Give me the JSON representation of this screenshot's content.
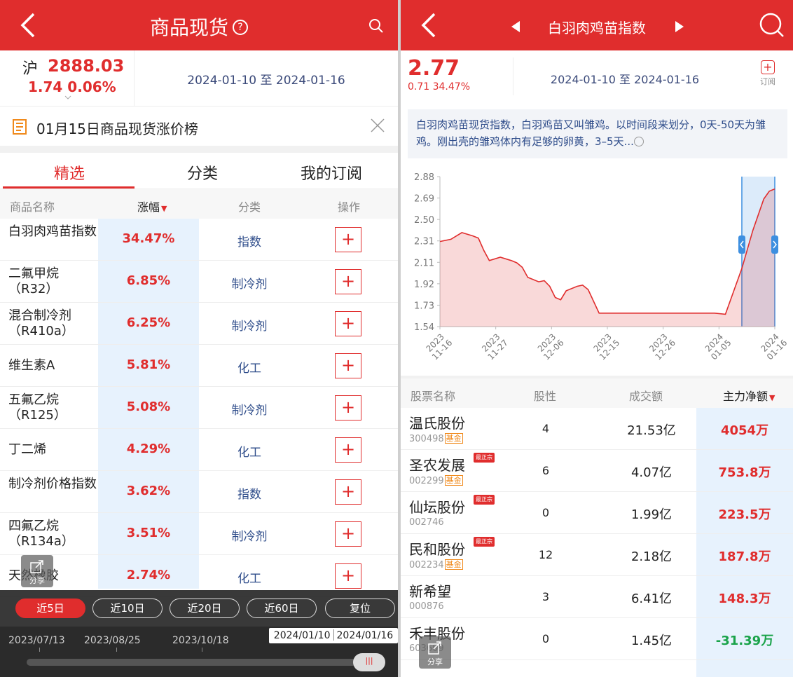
{
  "colors": {
    "brand_red": "#e02d2d",
    "up": "#e02d2d",
    "down": "#1aa34a",
    "link_blue": "#2e4c8a",
    "sort_bg": "#e7f2fd"
  },
  "left": {
    "header": {
      "title": "商品现货",
      "help_icon": "?"
    },
    "index": {
      "name": "沪",
      "value": "2888.03",
      "change": "1.74  0.06%"
    },
    "date_range": "2024-01-10 至 2024-01-16",
    "notice": {
      "text": "01月15日商品现货涨价榜"
    },
    "tabs": [
      {
        "label": "精选"
      },
      {
        "label": "分类"
      },
      {
        "label": "我的订阅"
      }
    ],
    "table": {
      "columns": {
        "name": "商品名称",
        "change": "涨幅",
        "sort_mark": "▼",
        "category": "分类",
        "action": "操作"
      },
      "rows": [
        {
          "name": "白羽肉鸡苗指数",
          "change": "34.47%",
          "category": "指数",
          "add": "+"
        },
        {
          "name": "二氟甲烷（R32）",
          "change": "6.85%",
          "category": "制冷剂",
          "add": "+"
        },
        {
          "name": "混合制冷剂（R410a）",
          "change": "6.25%",
          "category": "制冷剂",
          "add": "+"
        },
        {
          "name": "维生素A",
          "change": "5.81%",
          "category": "化工",
          "add": "+"
        },
        {
          "name": "五氟乙烷（R125）",
          "change": "5.08%",
          "category": "制冷剂",
          "add": "+"
        },
        {
          "name": "丁二烯",
          "change": "4.29%",
          "category": "化工",
          "add": "+"
        },
        {
          "name": "制冷剂价格指数",
          "change": "3.62%",
          "category": "指数",
          "add": "+"
        },
        {
          "name": "四氟乙烷（R134a）",
          "change": "3.51%",
          "category": "制冷剂",
          "add": "+"
        },
        {
          "name": "天然橡胶",
          "change": "2.74%",
          "category": "化工",
          "add": "+"
        }
      ]
    },
    "share_label": "分享",
    "period_buttons": [
      {
        "label": "近5日"
      },
      {
        "label": "近10日"
      },
      {
        "label": "近20日"
      },
      {
        "label": "近60日"
      },
      {
        "label": "复位"
      }
    ],
    "timeline": {
      "labels": [
        "2023/07/13",
        "2023/08/25",
        "2023/10/18"
      ],
      "tooltip": [
        "2024/01/10",
        "2024/01/16"
      ],
      "handle_icon": "|||"
    }
  },
  "right": {
    "header": {
      "title": "白羽肉鸡苗指数"
    },
    "price": "2.77",
    "change": "0.71  34.47%",
    "date_range": "2024-01-10 至 2024-01-16",
    "subscribe": {
      "icon": "+",
      "label": "订阅"
    },
    "description": "白羽肉鸡苗现货指数，白羽鸡苗又叫雏鸡。以时间段来划分，0天-50天为雏鸡。刚出壳的雏鸡体内有足够的卵黄，3–5天...",
    "table": {
      "columns": {
        "name": "股票名称",
        "nature": "股性",
        "volume": "成交额",
        "net": "主力净额",
        "sort_mark": "▼"
      },
      "rows": [
        {
          "name": "温氏股份",
          "code": "300498",
          "badge": "基金",
          "tag": "",
          "nature": "4",
          "volume": "21.53亿",
          "net": "4054万",
          "dir": "pos"
        },
        {
          "name": "圣农发展",
          "code": "002299",
          "badge": "基金",
          "tag": "最正宗",
          "nature": "6",
          "volume": "4.07亿",
          "net": "753.8万",
          "dir": "pos"
        },
        {
          "name": "仙坛股份",
          "code": "002746",
          "badge": "",
          "tag": "最正宗",
          "nature": "0",
          "volume": "1.99亿",
          "net": "223.5万",
          "dir": "pos"
        },
        {
          "name": "民和股份",
          "code": "002234",
          "badge": "基金",
          "tag": "最正宗",
          "nature": "12",
          "volume": "2.18亿",
          "net": "187.8万",
          "dir": "pos"
        },
        {
          "name": "新希望",
          "code": "000876",
          "badge": "",
          "tag": "",
          "nature": "3",
          "volume": "6.41亿",
          "net": "148.3万",
          "dir": "pos"
        },
        {
          "name": "禾丰股份",
          "code": "603609",
          "badge": "",
          "tag": "",
          "nature": "0",
          "volume": "1.45亿",
          "net": "-31.39万",
          "dir": "neg"
        }
      ]
    },
    "share_label": "分享"
  },
  "chart_data": {
    "type": "area",
    "x": [
      "2023-11-16",
      "2023-11-18",
      "2023-11-20",
      "2023-11-22",
      "2023-11-23",
      "2023-11-24",
      "2023-11-25",
      "2023-11-27",
      "2023-11-29",
      "2023-11-30",
      "2023-12-01",
      "2023-12-02",
      "2023-12-04",
      "2023-12-05",
      "2023-12-06",
      "2023-12-07",
      "2023-12-08",
      "2023-12-09",
      "2023-12-11",
      "2023-12-12",
      "2023-12-13",
      "2023-12-15",
      "2023-12-17",
      "2023-12-19",
      "2023-12-21",
      "2023-12-23",
      "2023-12-26",
      "2023-12-28",
      "2023-12-30",
      "2024-01-01",
      "2024-01-03",
      "2024-01-05",
      "2024-01-07",
      "2024-01-10",
      "2024-01-12",
      "2024-01-14",
      "2024-01-15",
      "2024-01-16"
    ],
    "values": [
      2.3,
      2.32,
      2.38,
      2.35,
      2.33,
      2.22,
      2.13,
      2.16,
      2.13,
      2.11,
      2.07,
      1.98,
      1.94,
      1.95,
      1.9,
      1.8,
      1.78,
      1.86,
      1.9,
      1.91,
      1.87,
      1.66,
      1.66,
      1.66,
      1.66,
      1.66,
      1.66,
      1.66,
      1.66,
      1.66,
      1.66,
      1.66,
      1.65,
      2.06,
      2.4,
      2.68,
      2.75,
      2.77
    ],
    "yticks": [
      "2.88",
      "2.69",
      "2.50",
      "2.31",
      "2.11",
      "1.92",
      "1.73",
      "1.54"
    ],
    "xticks": [
      "2023\n11-16",
      "2023\n11-27",
      "2023\n12-06",
      "2023\n12-15",
      "2023\n12-26",
      "2024\n01-05",
      "2024\n01-16"
    ],
    "ylim": [
      1.54,
      2.88
    ],
    "highlight_range": [
      "2024-01-10",
      "2024-01-16"
    ],
    "title": "",
    "xlabel": "",
    "ylabel": "",
    "grid": false
  }
}
